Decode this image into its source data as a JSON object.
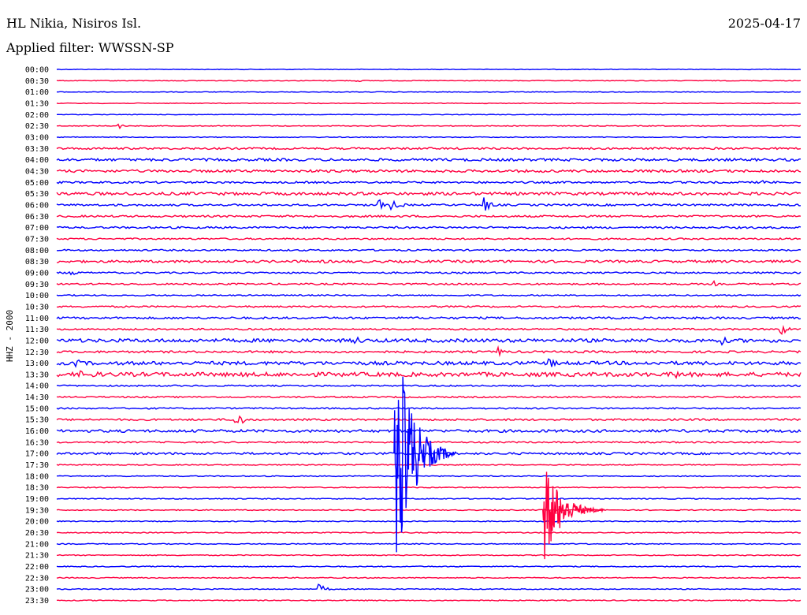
{
  "header": {
    "station": "HL Nikia, Nisiros Isl.",
    "date": "2025-04-17",
    "filter": "Applied filter: WWSSN-SP"
  },
  "chart_data": {
    "type": "line",
    "title": "HL Nikia, Nisiros Isl.",
    "subtitle": "Applied filter: WWSSN-SP",
    "date": "2025-04-17",
    "ylabel": "HHZ - 2000",
    "xlabel": "",
    "trace_colors": [
      "#0000ff",
      "#ff0040"
    ],
    "rows": [
      {
        "label": "00:00",
        "noise": 0.4
      },
      {
        "label": "00:30",
        "noise": 0.4
      },
      {
        "label": "01:00",
        "noise": 0.4
      },
      {
        "label": "01:30",
        "noise": 0.4
      },
      {
        "label": "02:00",
        "noise": 0.4
      },
      {
        "label": "02:30",
        "noise": 0.5
      },
      {
        "label": "03:00",
        "noise": 0.5
      },
      {
        "label": "03:30",
        "noise": 1.2
      },
      {
        "label": "04:00",
        "noise": 1.6
      },
      {
        "label": "04:30",
        "noise": 1.6
      },
      {
        "label": "05:00",
        "noise": 1.2
      },
      {
        "label": "05:30",
        "noise": 1.8
      },
      {
        "label": "06:00",
        "noise": 1.2
      },
      {
        "label": "06:30",
        "noise": 1.2
      },
      {
        "label": "07:00",
        "noise": 1.2
      },
      {
        "label": "07:30",
        "noise": 1.0
      },
      {
        "label": "08:00",
        "noise": 1.0
      },
      {
        "label": "08:30",
        "noise": 1.5
      },
      {
        "label": "09:00",
        "noise": 1.0
      },
      {
        "label": "09:30",
        "noise": 1.0
      },
      {
        "label": "10:00",
        "noise": 0.8
      },
      {
        "label": "10:30",
        "noise": 1.0
      },
      {
        "label": "11:00",
        "noise": 1.3
      },
      {
        "label": "11:30",
        "noise": 1.0
      },
      {
        "label": "12:00",
        "noise": 2.2
      },
      {
        "label": "12:30",
        "noise": 1.3
      },
      {
        "label": "13:00",
        "noise": 2.2
      },
      {
        "label": "13:30",
        "noise": 2.6
      },
      {
        "label": "14:00",
        "noise": 0.9
      },
      {
        "label": "14:30",
        "noise": 0.9
      },
      {
        "label": "15:00",
        "noise": 0.9
      },
      {
        "label": "15:30",
        "noise": 1.2
      },
      {
        "label": "16:00",
        "noise": 1.7
      },
      {
        "label": "16:30",
        "noise": 0.9
      },
      {
        "label": "17:00",
        "noise": 1.3
      },
      {
        "label": "17:30",
        "noise": 0.6
      },
      {
        "label": "18:00",
        "noise": 0.6
      },
      {
        "label": "18:30",
        "noise": 0.6
      },
      {
        "label": "19:00",
        "noise": 0.6
      },
      {
        "label": "19:30",
        "noise": 0.6
      },
      {
        "label": "20:00",
        "noise": 0.6
      },
      {
        "label": "20:30",
        "noise": 0.6
      },
      {
        "label": "21:00",
        "noise": 0.6
      },
      {
        "label": "21:30",
        "noise": 0.6
      },
      {
        "label": "22:00",
        "noise": 0.6
      },
      {
        "label": "22:30",
        "noise": 0.6
      },
      {
        "label": "23:00",
        "noise": 0.6
      },
      {
        "label": "23:30",
        "noise": 0.6
      }
    ],
    "events": [
      {
        "row": "00:30",
        "minute": 12,
        "amplitude": 2,
        "duration": 1.2
      },
      {
        "row": "02:30",
        "minute": 2.5,
        "amplitude": 4,
        "duration": 0.6
      },
      {
        "row": "05:00",
        "minute": 28.5,
        "amplitude": 3,
        "duration": 0.8
      },
      {
        "row": "05:30",
        "minute": 19.5,
        "amplitude": 4,
        "duration": 1.4
      },
      {
        "row": "06:00",
        "minute": 13.5,
        "amplitude": 6,
        "duration": 1.5
      },
      {
        "row": "06:00",
        "minute": 13.0,
        "amplitude": 11,
        "duration": 0.4
      },
      {
        "row": "06:00",
        "minute": 17.2,
        "amplitude": 11,
        "duration": 1.0
      },
      {
        "row": "08:30",
        "minute": 10.8,
        "amplitude": 5,
        "duration": 0.3
      },
      {
        "row": "09:00",
        "minute": 0.5,
        "amplitude": 6,
        "duration": 0.9
      },
      {
        "row": "09:30",
        "minute": 26.5,
        "amplitude": 4,
        "duration": 0.5
      },
      {
        "row": "11:00",
        "minute": 25.8,
        "amplitude": 4,
        "duration": 0.5
      },
      {
        "row": "11:30",
        "minute": 29.2,
        "amplitude": 9,
        "duration": 0.8
      },
      {
        "row": "12:00",
        "minute": 12.0,
        "amplitude": 7,
        "duration": 1.2
      },
      {
        "row": "12:00",
        "minute": 26.8,
        "amplitude": 6,
        "duration": 1.2
      },
      {
        "row": "12:30",
        "minute": 17.8,
        "amplitude": 6,
        "duration": 1.0
      },
      {
        "row": "13:00",
        "minute": 0.8,
        "amplitude": 5,
        "duration": 1.5
      },
      {
        "row": "13:00",
        "minute": 19.8,
        "amplitude": 11,
        "duration": 0.8
      },
      {
        "row": "13:30",
        "minute": 1.0,
        "amplitude": 5,
        "duration": 4.5
      },
      {
        "row": "13:30",
        "minute": 25.0,
        "amplitude": 7,
        "duration": 1.0
      },
      {
        "row": "15:30",
        "minute": 7.2,
        "amplitude": 18,
        "duration": 0.8
      },
      {
        "row": "17:00",
        "minute": 13.6,
        "amplitude": 160,
        "duration": 2.5
      },
      {
        "row": "19:30",
        "minute": 19.6,
        "amplitude": 65,
        "duration": 2.5
      },
      {
        "row": "23:00",
        "minute": 10.6,
        "amplitude": 6,
        "duration": 1.0
      }
    ]
  }
}
